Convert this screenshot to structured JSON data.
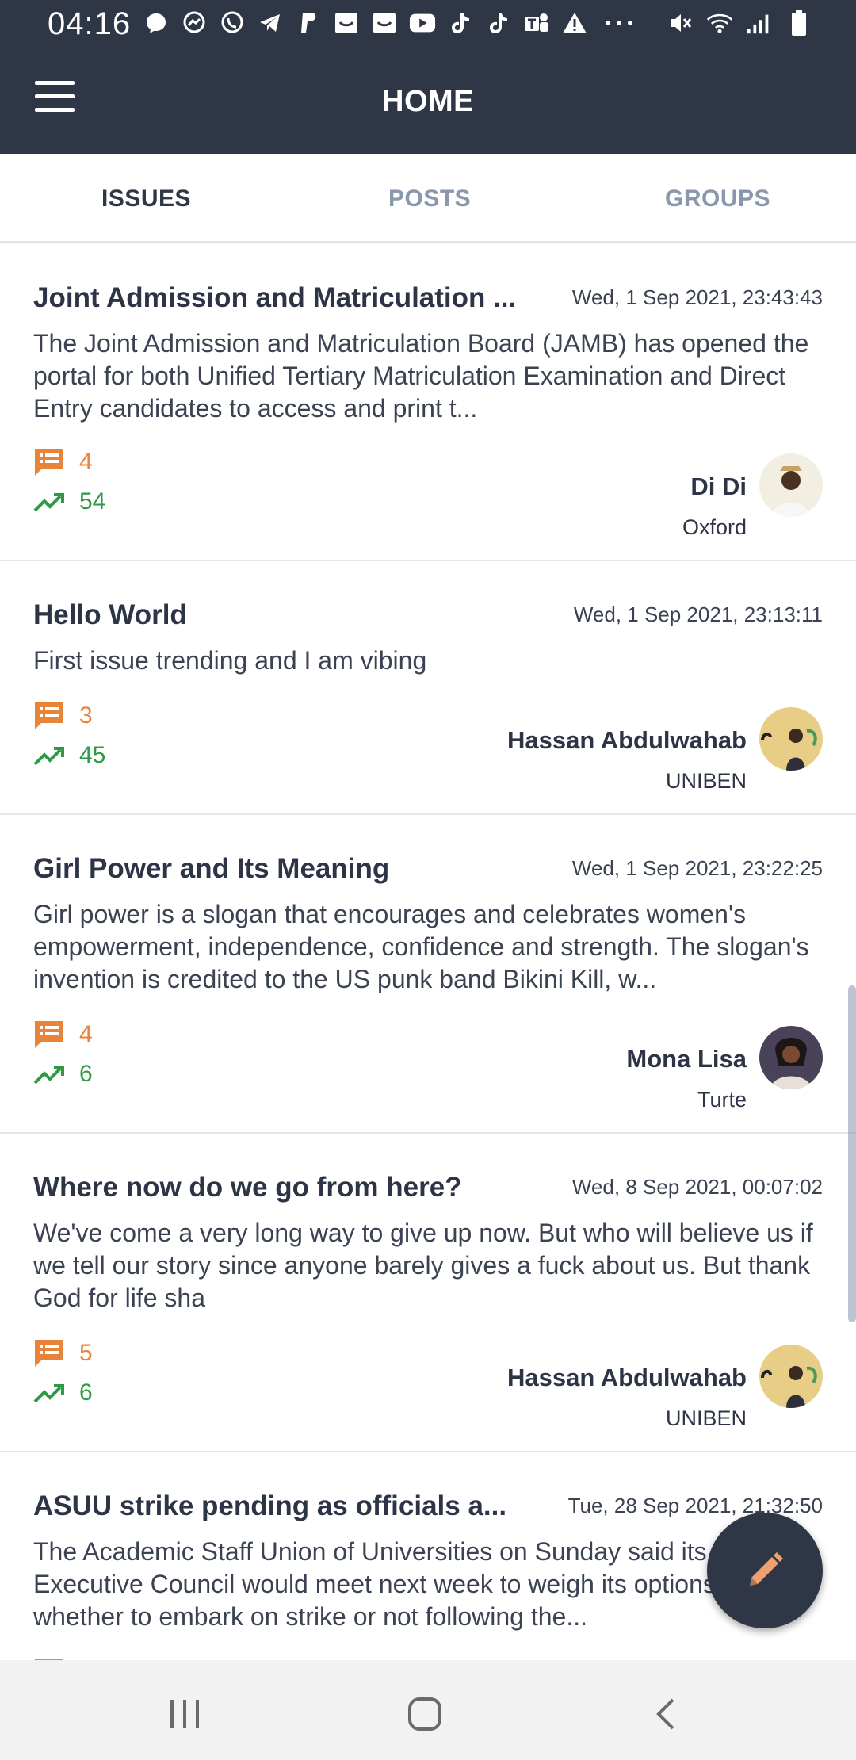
{
  "status_bar": {
    "time": "04:16",
    "app_icons": [
      "chat-bubble-icon",
      "messenger-icon",
      "whatsapp-icon",
      "telegram-icon",
      "paypal-icon",
      "inbox-icon",
      "inbox-icon",
      "youtube-icon",
      "tiktok-icon",
      "tiktok-icon",
      "teams-icon",
      "warning-icon",
      "more-dots-icon"
    ],
    "system_icons": [
      "mute-icon",
      "wifi-icon",
      "signal-icon",
      "battery-icon"
    ]
  },
  "app_bar": {
    "title": "HOME"
  },
  "tabs": [
    {
      "label": "ISSUES",
      "active": true
    },
    {
      "label": "POSTS",
      "active": false
    },
    {
      "label": "GROUPS",
      "active": false
    }
  ],
  "colors": {
    "primary": "#2f3747",
    "comments": "#e8833a",
    "trend": "#2f9a46",
    "tab_inactive": "#8a97ad"
  },
  "issues": [
    {
      "title": "Joint Admission and Matriculation ...",
      "date": "Wed, 1 Sep 2021, 23:43:43",
      "body": "The Joint Admission and Matriculation Board (JAMB) has opened the portal for both Unified Tertiary Matriculation Examination and Direct Entry candidates to access and print t...",
      "comments": "4",
      "trend": "54",
      "author": "Di Di",
      "school": "Oxford"
    },
    {
      "title": "Hello World",
      "date": "Wed, 1 Sep 2021, 23:13:11",
      "body": "First issue trending and I am vibing",
      "comments": "3",
      "trend": "45",
      "author": "Hassan Abdulwahab",
      "school": "UNIBEN"
    },
    {
      "title": "Girl Power and Its Meaning",
      "date": "Wed, 1 Sep 2021, 23:22:25",
      "body": "Girl power is a slogan that encourages and celebrates women's empowerment, independence, confidence and strength. The slogan's invention is credited to the US punk band Bikini Kill, w...",
      "comments": "4",
      "trend": "6",
      "author": "Mona Lisa",
      "school": "Turte"
    },
    {
      "title": "Where now do we go from here?",
      "date": "Wed, 8 Sep 2021, 00:07:02",
      "body": "We've come a very long way to give up now. But who will believe us if we tell our story since anyone barely gives a fuck about us. But thank God for life sha",
      "comments": "5",
      "trend": "6",
      "author": "Hassan Abdulwahab",
      "school": "UNIBEN"
    },
    {
      "title": "ASUU strike pending as officials a...",
      "date": "Tue, 28 Sep 2021, 21:32:50",
      "body": "The Academic Staff Union of Universities on Sunday said its National Executive Council would meet next week to weigh its options on whether to embark on strike or not following the...",
      "comments": "",
      "trend": "",
      "author": "",
      "school": ""
    }
  ],
  "fab": {
    "icon": "pencil-icon"
  },
  "nav_bar": {
    "buttons": [
      "recent-apps-icon",
      "home-icon",
      "back-icon"
    ]
  }
}
